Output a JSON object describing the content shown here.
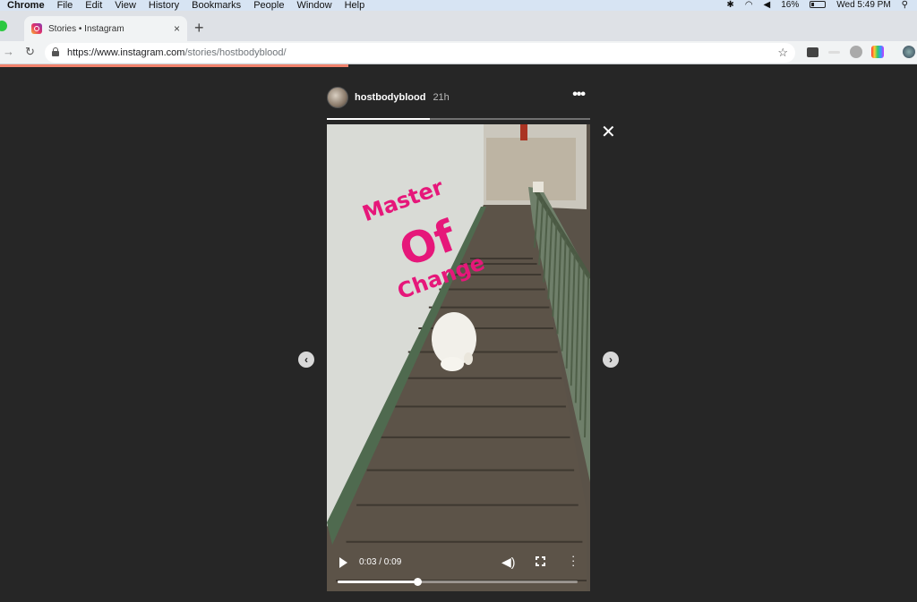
{
  "menubar": {
    "app": "Chrome",
    "menus": [
      "File",
      "Edit",
      "View",
      "History",
      "Bookmarks",
      "People",
      "Window",
      "Help"
    ],
    "status": {
      "icons": [
        "bluetooth-icon",
        "wifi-icon",
        "volume-icon",
        "battery-icon",
        "spotlight-icon"
      ],
      "battery": "16%",
      "clock": "Wed 5:49 PM"
    }
  },
  "browser": {
    "tab": {
      "title": "Stories • Instagram",
      "close": "×"
    },
    "new_tab": "+",
    "back": "→",
    "reload": "↻",
    "url_host": "https://www.instagram.com",
    "url_path": "/stories/hostbodyblood/",
    "star": "☆",
    "extensions": [
      "cast-extension-icon",
      "dash-extension-icon",
      "puzzle-extension-icon",
      "color-extension-icon",
      "profile-avatar-icon"
    ],
    "page_load_progress": 0.38
  },
  "story": {
    "username": "hostbodyblood",
    "posted": "21h",
    "more": "•••",
    "close": "✕",
    "progress": 0.39,
    "caption": {
      "line1": "Master",
      "line2": "Of",
      "line3": "Change"
    },
    "player": {
      "timecode": "0:03 / 0:09",
      "current_seconds": 3,
      "duration_seconds": 9,
      "volume_icon": "🔊"
    },
    "prev_arrow": "‹",
    "next_arrow": "›"
  },
  "colors": {
    "caption": "#e6177a",
    "background": "#262626",
    "loadbar": "#f2826c"
  }
}
